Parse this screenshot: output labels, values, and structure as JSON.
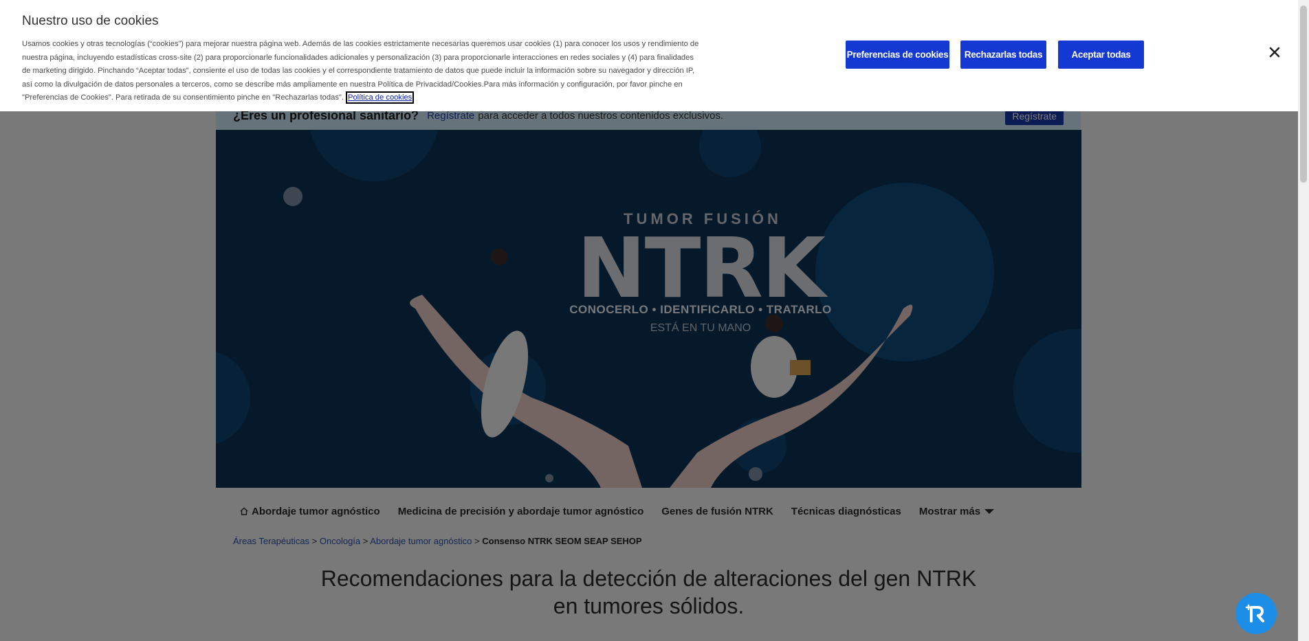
{
  "promo": {
    "question": "¿Eres un profesional sanitario?",
    "link": "Regístrate",
    "rest": "para acceder a todos nuestros contenidos exclusivos.",
    "button": "Regístrate"
  },
  "hero": {
    "kicker": "TUMOR FUSIÓN",
    "logo": "NTRK",
    "steps": "CONOCERLO  •  IDENTIFICARLO  •  TRATARLO",
    "tagline": "ESTÁ EN TU MANO"
  },
  "nav": {
    "items": [
      "Abordaje tumor agnóstico",
      "Medicina de precisión y abordaje tumor agnóstico",
      "Genes de fusión NTRK",
      "Técnicas diagnósticas"
    ],
    "more": "Mostrar más"
  },
  "breadcrumb": {
    "items": [
      "Áreas Terapéuticas",
      "Oncología",
      "Abordaje tumor agnóstico"
    ],
    "separator": " > ",
    "current": "Consenso NTRK SEOM SEAP SEHOP"
  },
  "title": {
    "line1": "Recomendaciones para la detección de alteraciones del gen NTRK",
    "line2": "en tumores sólidos."
  },
  "cookie": {
    "title": "Nuestro uso de cookies",
    "text": "Usamos cookies y otras tecnologías (“cookies”) para mejorar nuestra página web. Además de las cookies estrictamente necesarias queremos usar cookies (1) para conocer los usos y rendimiento de nuestra página, incluyendo estadísticas cross-site (2) para proporcionarle funcionalidades adicionales y personalización (3) para proporcionarle interacciones en redes sociales y (4) para finalidades de marketing dirigido. Pinchando “Aceptar todas”, consiente el uso de todas las cookies y el correspondiente tratamiento de datos que puede incluir la información sobre su navegador y dirección IP, así como la divulgación de datos personales a terceros, como se describe más ampliamente en nuestra Política de Privacidad/Cookies.Para más información y configuración, por favor pinche en \"Preferencias de Cookies\". Para retirada de su consentimiento pinche en \"Rechazarlas todas\".",
    "policy_link": "Política de cookies",
    "btn_preferences": "Preferencias de cookies",
    "btn_reject": "Rechazarlas todas",
    "btn_accept": "Aceptar todas"
  },
  "colors": {
    "primary_button": "#1438d2",
    "hero_bg": "#0d3355",
    "link": "#2b4ea8"
  }
}
